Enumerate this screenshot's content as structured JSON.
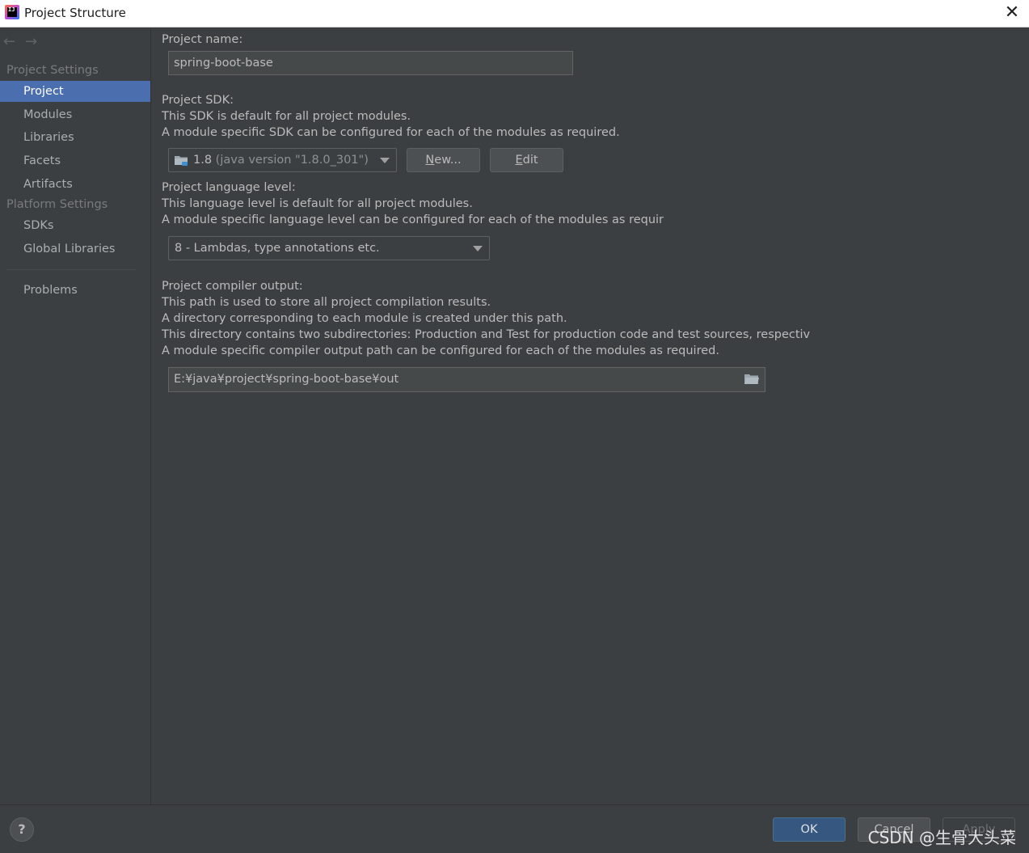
{
  "window": {
    "title": "Project Structure",
    "app_icon_text": "IJ",
    "close_glyph": "✕"
  },
  "sidebar": {
    "nav_back": "←",
    "nav_forward": "→",
    "project_settings_header": "Project Settings",
    "platform_settings_header": "Platform Settings",
    "items": [
      {
        "label": "Project",
        "selected": true
      },
      {
        "label": "Modules"
      },
      {
        "label": "Libraries"
      },
      {
        "label": "Facets"
      },
      {
        "label": "Artifacts"
      },
      {
        "label": "SDKs"
      },
      {
        "label": "Global Libraries"
      },
      {
        "label": "Problems"
      }
    ]
  },
  "project_name": {
    "label": "Project name:",
    "value": "spring-boot-base"
  },
  "project_sdk": {
    "label": "Project SDK:",
    "desc1": "This SDK is default for all project modules.",
    "desc2": "A module specific SDK can be configured for each of the modules as required.",
    "selected_version": "1.8",
    "selected_detail": "(java version \"1.8.0_301\")",
    "new_button": {
      "mnemonic": "N",
      "rest": "ew..."
    },
    "edit_button": {
      "mnemonic": "E",
      "rest": "dit"
    }
  },
  "language_level": {
    "label": "Project language level:",
    "desc1": "This language level is default for all project modules.",
    "desc2": "A module specific language level can be configured for each of the modules as requir",
    "selected": "8 - Lambdas, type annotations etc."
  },
  "compiler_output": {
    "label": "Project compiler output:",
    "desc1": "This path is used to store all project compilation results.",
    "desc2": "A directory corresponding to each module is created under this path.",
    "desc3": "This directory contains two subdirectories: Production and Test for production code and test sources, respectiv",
    "desc4": "A module specific compiler output path can be configured for each of the modules as required.",
    "path": "E:¥java¥project¥spring-boot-base¥out"
  },
  "footer": {
    "help_label": "?",
    "ok_label": "OK",
    "cancel_label": "Cancel",
    "apply_label": "Apply"
  },
  "watermark": "CSDN @生骨大头菜",
  "icons": [
    "app-icon",
    "close-icon",
    "back-arrow-icon",
    "forward-arrow-icon",
    "folder-icon",
    "browse-folder-icon",
    "help-icon",
    "dropdown-arrow-icon"
  ],
  "colors": {
    "background": "#3c3f41",
    "selection": "#4b6eaf",
    "primary_button": "#365880",
    "text": "#bbbbbb"
  }
}
